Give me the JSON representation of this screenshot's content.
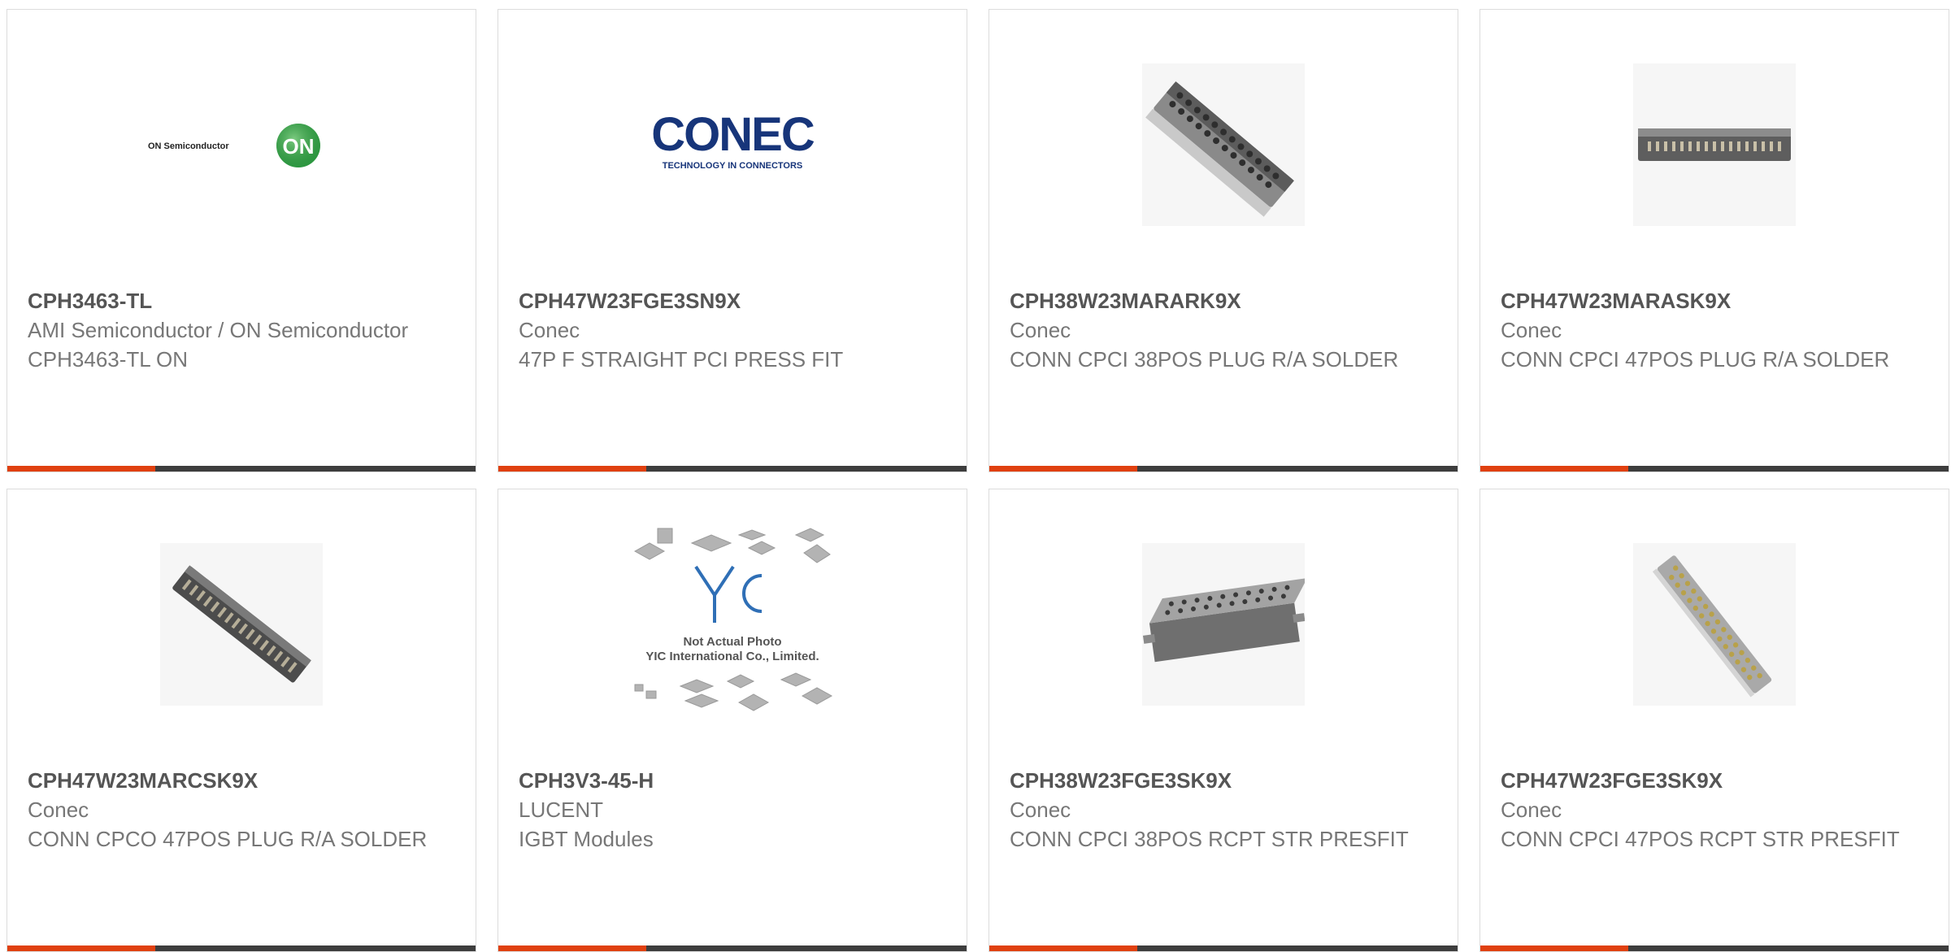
{
  "colors": {
    "accent": "#e0400f",
    "bar_dark": "#3d3d3d",
    "part_text": "#555555",
    "body_text": "#777777",
    "card_border": "#dcdcdc"
  },
  "products": [
    {
      "part_number": "CPH3463-TL",
      "manufacturer": "AMI Semiconductor / ON Semiconductor",
      "description": "CPH3463-TL ON",
      "image": "on-semiconductor-logo",
      "logo_text": "ON Semiconductor",
      "logo_badge": "ON"
    },
    {
      "part_number": "CPH47W23FGE3SN9X",
      "manufacturer": "Conec",
      "description": "47P F STRAIGHT PCI PRESS FIT",
      "image": "conec-logo",
      "logo_text": "CONEC",
      "logo_tagline": "TECHNOLOGY IN CONNECTORS"
    },
    {
      "part_number": "CPH38W23MARARK9X",
      "manufacturer": "Conec",
      "description": "CONN CPCI 38POS PLUG R/A SOLDER",
      "image": "connector-photo-angled"
    },
    {
      "part_number": "CPH47W23MARASK9X",
      "manufacturer": "Conec",
      "description": "CONN CPCI 47POS PLUG R/A SOLDER",
      "image": "connector-photo-side"
    },
    {
      "part_number": "CPH47W23MARCSK9X",
      "manufacturer": "Conec",
      "description": "CONN CPCO 47POS PLUG R/A SOLDER",
      "image": "connector-photo-diagonal"
    },
    {
      "part_number": "CPH3V3-45-H",
      "manufacturer": "LUCENT",
      "description": "IGBT Modules",
      "image": "not-actual-photo-placeholder",
      "placeholder_line1": "Not Actual Photo",
      "placeholder_line2": "YIC International Co., Limited."
    },
    {
      "part_number": "CPH38W23FGE3SK9X",
      "manufacturer": "Conec",
      "description": "CONN CPCI 38POS RCPT STR PRESFIT",
      "image": "receptacle-photo-flat"
    },
    {
      "part_number": "CPH47W23FGE3SK9X",
      "manufacturer": "Conec",
      "description": "CONN CPCI 47POS RCPT STR PRESFIT",
      "image": "receptacle-photo-diagonal"
    }
  ]
}
